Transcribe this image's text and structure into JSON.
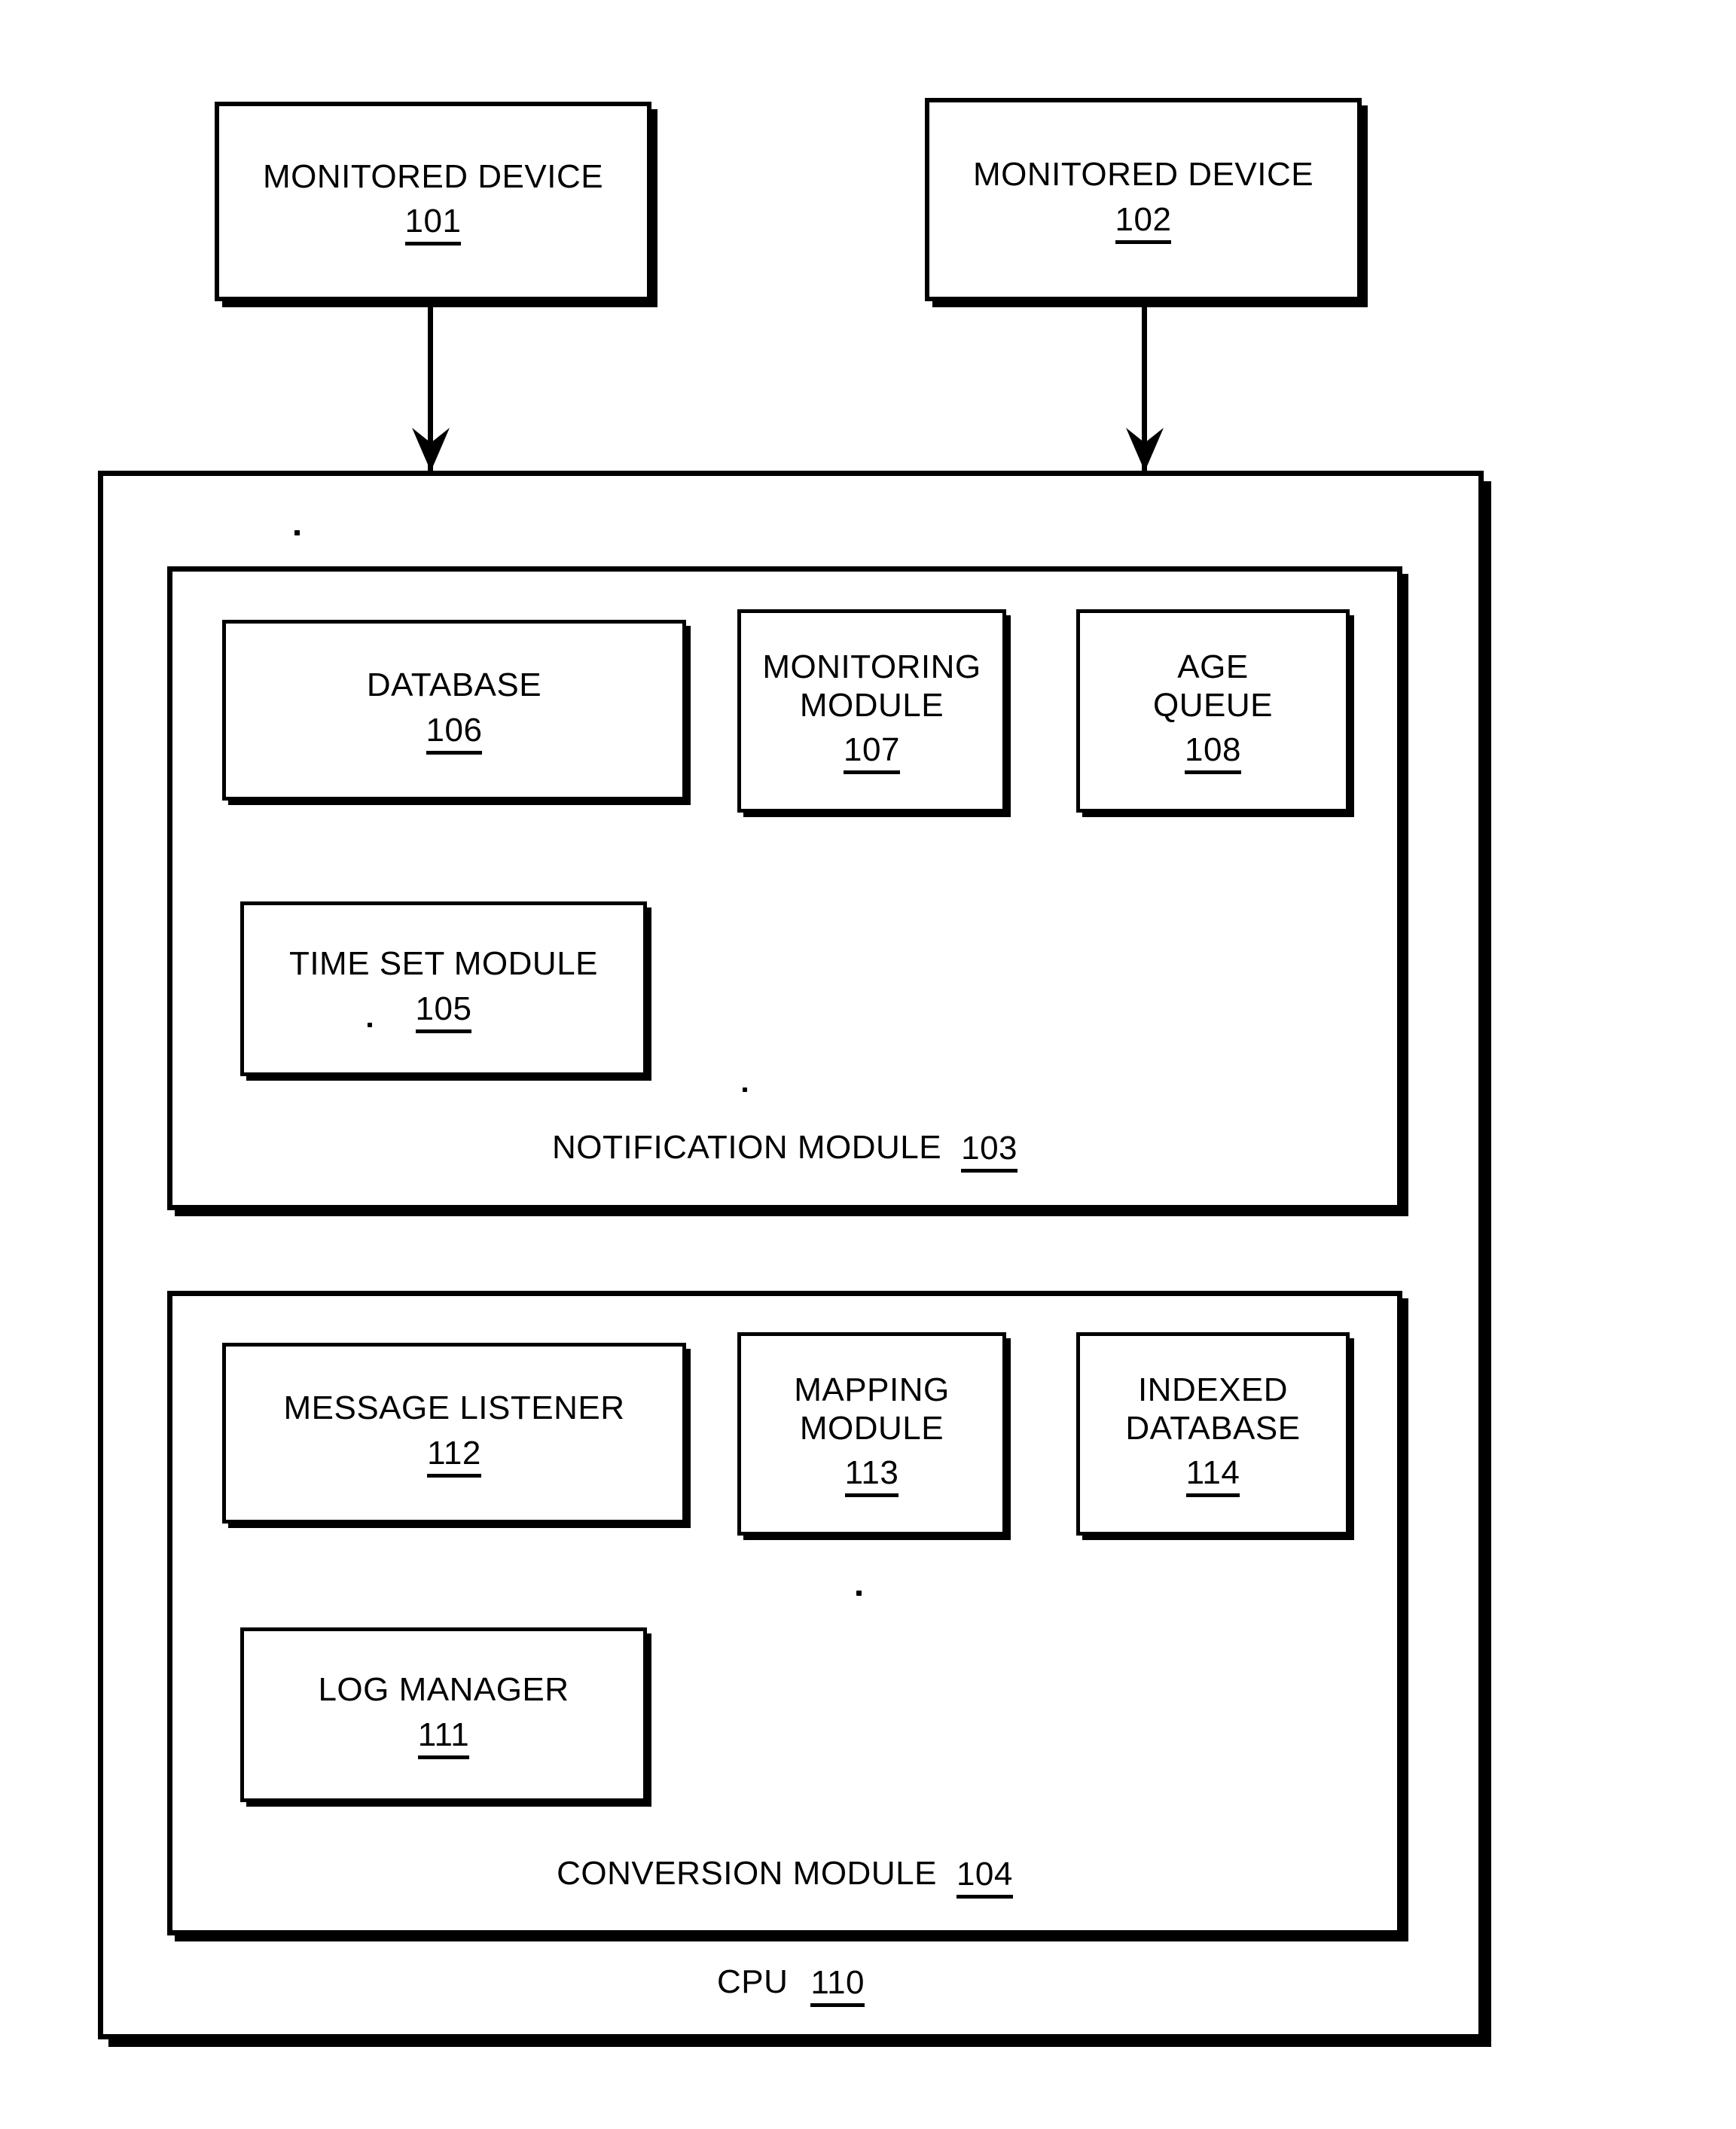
{
  "figure": {
    "title": "System block diagram",
    "background_color": "#ffffff",
    "line_color": "#000000"
  },
  "top_devices": [
    {
      "label": "MONITORED DEVICE",
      "numeral": "101"
    },
    {
      "label": "MONITORED DEVICE",
      "numeral": "102"
    }
  ],
  "cpu": {
    "caption": "CPU",
    "numeral": "110"
  },
  "notification_module": {
    "caption": "NOTIFICATION MODULE",
    "numeral": "103",
    "blocks": [
      {
        "label": "DATABASE",
        "numeral": "106"
      },
      {
        "label_line1": "MONITORING",
        "label_line2": "MODULE",
        "numeral": "107"
      },
      {
        "label_line1": "AGE",
        "label_line2": "QUEUE",
        "numeral": "108"
      },
      {
        "label": "TIME SET MODULE",
        "numeral": "105"
      }
    ]
  },
  "conversion_module": {
    "caption": "CONVERSION MODULE",
    "numeral": "104",
    "blocks": [
      {
        "label": "MESSAGE LISTENER",
        "numeral": "112"
      },
      {
        "label_line1": "MAPPING",
        "label_line2": "MODULE",
        "numeral": "113"
      },
      {
        "label_line1": "INDEXED",
        "label_line2": "DATABASE",
        "numeral": "114"
      },
      {
        "label": "LOG MANAGER",
        "numeral": "111"
      }
    ]
  },
  "connectors": [
    {
      "name": "device-101-to-cpu",
      "direction": "down"
    },
    {
      "name": "device-102-to-cpu",
      "direction": "down"
    }
  ]
}
